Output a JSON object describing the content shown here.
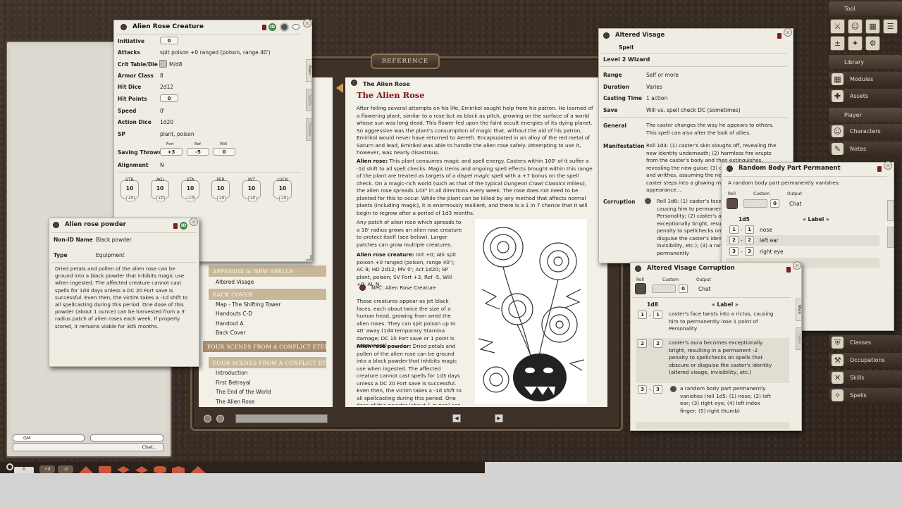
{
  "left_panel": {
    "gm_label": "GM",
    "chat_label": "Chat..."
  },
  "bottom_bar": {
    "btn_a": "+d",
    "btn_b": "-d",
    "zero": "0"
  },
  "book": {
    "reference_tab": "REFERENCE",
    "toc": {
      "appendix_head": "APPENDIX A: NEW SPELLS",
      "appendix_items": [
        "Altered Visage"
      ],
      "back_cover_head": "BACK COVER",
      "back_cover_items": [
        "Map - The Shifting Tower",
        "Handouts C-D",
        "Handout A",
        "Back Cover"
      ],
      "four_scenes_head_1": "FOUR SCENES FROM A CONFLICT ETERNAL",
      "four_scenes_head_2": "FOUR SCENES FROM A CONFLICT ETERNAL",
      "four_scenes_items": [
        "Introduction",
        "First Betrayal",
        "The End of the World",
        "The Alien Rose"
      ]
    },
    "page": {
      "header": "The Alien Rose",
      "title": "The Alien Rose",
      "intro": "After foiling several attempts on his life, Emirikol sought help from his patron. He learned of a flowering plant, similar to a rose but as black as pitch, growing on the surface of a world whose sun was long dead. This flower fed upon the faint occult energies of its dying planet. So aggressive was the plant's consumption of magic that, without the aid of his patron, Emirikol would never have returned to Aereth. Encapsulated in an alloy of the red metal of Saturn and lead, Emirikol was able to handle the alien rose safely. Attempting to use it, however, was nearly disastrous.",
      "rose_label": "Alien rose:",
      "rose_text": " This plant consumes magic and spell energy. Casters within 100' of it suffer a -1d shift to all spell checks. Magic items and ongoing spell effects brought within this range of the plant are treated as targets of a ",
      "rose_italic": "dispel magic",
      "rose_text2": " spell with a +7 bonus on the spell check. On a magic-rich world (such as that of the typical ",
      "rose_italic2": "Dungeon Crawl Classics",
      "rose_text3": " milieu), the alien rose spreads 1d3\" in all directions every week. The rose does not need to be planted for this to occur. While the plant can be killed by any method that affects normal plants (including magic), it is enormously resilient, and there is a 1 in 7 chance that it will begin to regrow after a period of 1d3 months.",
      "patch_text": "Any patch of alien rose which spreads to a 10' radius grows an alien rose creature to protect itself (see below). Larger patches can grow multiple creatures.",
      "creature_label": "Alien rose creature:",
      "creature_text": " Init +0; Atk spit poison +0 ranged (poison, range 40'); AC 8; HD 2d12; MV 0'; Act 1d20; SP plant, poison; SV Fort +3, Ref -5, Will +0; AL N.",
      "npc_link": "NPC: Alien Rose Creature",
      "creatures_appear": "These creatures appear as jet black faces, each about twice the size of a human head, growing from amid the alien roses. They can spit poison up to 40' away (1d4 temporary Stamina damage; DC 10 Fort save or 1 point is permanent).",
      "powder_label": "Alien rose powder:",
      "powder_text": " Dried petals and pollen of the alien rose can be ground into a black powder that inhibits magic use when ingested. The affected creature cannot cast spells for 1d3 days unless a DC 20 Fort save is successful. Even then, the victim takes a -1d shift to all spellcasting during this period. One dose of this powder (about 1 ounce) can be"
    }
  },
  "creature_window": {
    "title": "Alien Rose Creature",
    "tabs": [
      "Main",
      "Spells",
      "Powers"
    ],
    "fields": [
      {
        "label": "Initiative",
        "value": "0",
        "boxed": true
      },
      {
        "label": "Attacks",
        "value": "spit poison +0 ranged (poison, range 40')"
      },
      {
        "label": "Crit Table/Die",
        "value": "M/d8"
      },
      {
        "label": "Armor Class",
        "value": "8"
      },
      {
        "label": "Hit Dice",
        "value": "2d12"
      },
      {
        "label": "Hit Points",
        "value": "0",
        "boxed": true
      },
      {
        "label": "Speed",
        "value": "0'"
      },
      {
        "label": "Action Dice",
        "value": "1d20"
      },
      {
        "label": "SP",
        "value": "plant, poison"
      }
    ],
    "saves": {
      "label": "Saving Throws",
      "fort_label": "Fort",
      "ref_label": "Ref",
      "will_label": "Will",
      "fort": "+3",
      "ref": "-5",
      "will": "0"
    },
    "alignment_label": "Alignment",
    "alignment": "N",
    "attributes": [
      {
        "name": "STR",
        "value": "10",
        "mod": "+0"
      },
      {
        "name": "AGI",
        "value": "10",
        "mod": "+0"
      },
      {
        "name": "STA",
        "value": "10",
        "mod": "+0"
      },
      {
        "name": "PER",
        "value": "10",
        "mod": "+0"
      },
      {
        "name": "INT",
        "value": "10",
        "mod": "+0"
      },
      {
        "name": "LUCK",
        "value": "10",
        "mod": "+0"
      }
    ],
    "id_badge": "ID"
  },
  "powder_window": {
    "title": "Alien rose powder",
    "nonid_label": "Non-ID Name",
    "nonid_value": "Black powder",
    "type_label": "Type",
    "type_value": "Equipment",
    "desc": "Dried petals and pollen of the alien rose can be ground into a black powder that inhibits magic use when ingested. The affected creature cannot cast spells for 1d3 days unless a DC 20 Fort save is successful. Even then, the victim takes a -1d shift to all spellcasting during this period. One dose of this powder (about 1 ounce) can be harvested from a 3' radius patch of alien roses each week. If properly stored, it remains viable for 3d5 months.",
    "id_badge": "ID"
  },
  "spell_window": {
    "title": "Altered Visage",
    "subtitle": "Spell",
    "level": "Level 2 Wizard",
    "fields": [
      {
        "label": "Range",
        "value": "Self or more"
      },
      {
        "label": "Duration",
        "value": "Varies"
      },
      {
        "label": "Casting Time",
        "value": "1 action"
      },
      {
        "label": "Save",
        "value": "Will vs. spell check DC (sometimes)"
      }
    ],
    "general_label": "General",
    "general": "The caster changes the way he appears to others. This spell can also alter the look of allies.",
    "manifestation_label": "Manifestation",
    "manifestation": "Roll 1d4: (1) caster's skin sloughs off, revealing the new identity underneath; (2) harmless fire erupts from the caster's body and then extinguishes, revealing the new guise; (3) caster's flesh bubbles and writhes, assuming the new identity; (4) the caster steps into a glowing mirror, changing appearance...",
    "corruption_label": "Corruption",
    "corruption": "Roll 1d8: (1) caster's face twists into a rictus, causing him to permanently lose 1 point of Personality; (2) caster's aura becomes exceptionally bright, resulting in a permanent -2 penalty to spellchecks on spells that obscure or disguise the caster's identity (altered visage, invisibility, etc.); (3) a random body part permanently"
  },
  "bodypart_window": {
    "title": "Random Body Part Permanent",
    "desc": "A random body part permanently vanishes:",
    "roll_label": "Roll",
    "custom_label": "Custom",
    "output_label": "Output",
    "custom_value": "0",
    "output_value": "Chat",
    "die": "1d5",
    "col_label": "« Label »",
    "rows": [
      {
        "from": "1",
        "to": "1",
        "label": "nose"
      },
      {
        "from": "2",
        "to": "2",
        "label": "left ear"
      },
      {
        "from": "3",
        "to": "3",
        "label": "right eye"
      }
    ]
  },
  "corruption_window": {
    "title": "Altered Visage Corruption",
    "roll_label": "Roll",
    "custom_label": "Custom",
    "output_label": "Output",
    "custom_value": "0",
    "output_value": "Chat",
    "die": "1d8",
    "col_label": "« Label »",
    "rows": [
      {
        "from": "1",
        "to": "1",
        "label": "caster's face twists into a rictus, causing him to permanently lose 1 point of Personality"
      },
      {
        "from": "2",
        "to": "2",
        "label": "caster's aura becomes exceptionally bright, resulting in a permanent -2 penalty to spellchecks on spells that obscure or disguise the caster's identity (altered visage, invisibility, etc.)"
      },
      {
        "from": "3",
        "to": "3",
        "label": "a random body part permanently vanishes (roll 1d5: (1) nose; (2) left ear; (3) right eye; (4) left index finger; (5) right thumb)"
      }
    ],
    "tabs": [
      "Main",
      "Table"
    ]
  },
  "sidebar": {
    "tool_head": "Tool",
    "library_head": "Library",
    "library_items": [
      "Modules",
      "Assets"
    ],
    "player_head": "Player",
    "player_items": [
      "Characters",
      "Notes"
    ],
    "lower_items": [
      "Classes",
      "Occupations",
      "Skills",
      "Spells"
    ]
  }
}
